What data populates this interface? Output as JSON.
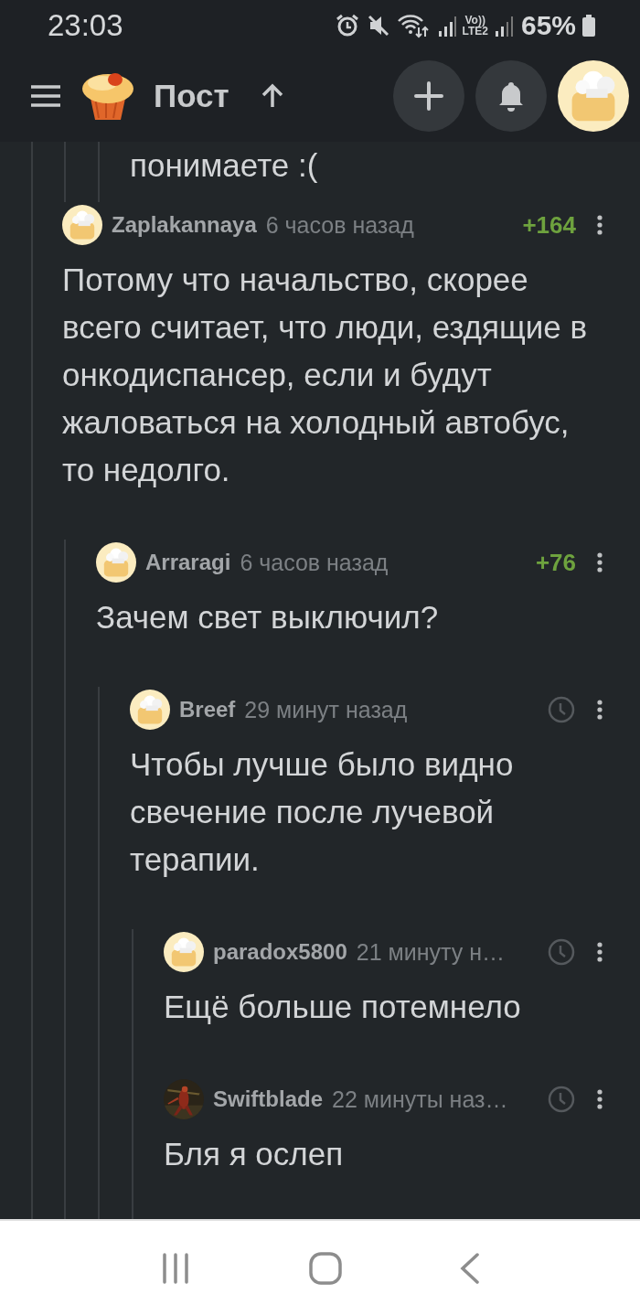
{
  "status_bar": {
    "time": "23:03",
    "volte_label": "Vo))",
    "lte_label": "LTE2",
    "battery": "65%"
  },
  "header": {
    "title": "Пост"
  },
  "comments": [
    {
      "kind": "continued",
      "children": [
        {
          "kind": "continued",
          "children": [
            {
              "kind": "fragment",
              "body": "понимаете :("
            }
          ]
        }
      ]
    },
    {
      "kind": "comment",
      "avatar": {
        "kind": "default"
      },
      "author": "Zaplakannaya",
      "time": "6 часов назад",
      "rating": "+164",
      "body": "Потому что начальство, скорее всего считает, что люди, ездящие в онкодиспансер, если и будут жаловаться на холодный автобус, то недолго.",
      "children": [
        {
          "kind": "comment",
          "avatar": {
            "kind": "default"
          },
          "author": "Arraragi",
          "time": "6 часов назад",
          "rating": "+76",
          "body": "Зачем свет выключил?",
          "children": [
            {
              "kind": "comment",
              "avatar": {
                "kind": "default"
              },
              "author": "Breef",
              "time": "29 минут назад",
              "rating_hidden": true,
              "body": "Чтобы лучше было видно свечение после лучевой терапии.",
              "children": [
                {
                  "kind": "comment",
                  "avatar": {
                    "kind": "default"
                  },
                  "author": "paradox5800",
                  "time": "21 минуту н…",
                  "rating_hidden": true,
                  "body": "Ещё больше потемнело"
                },
                {
                  "kind": "comment",
                  "author": "Swiftblade",
                  "time": "22 минуты наз…",
                  "rating_hidden": true,
                  "body": "Бля я ослеп"
                }
              ]
            }
          ]
        }
      ]
    }
  ]
}
